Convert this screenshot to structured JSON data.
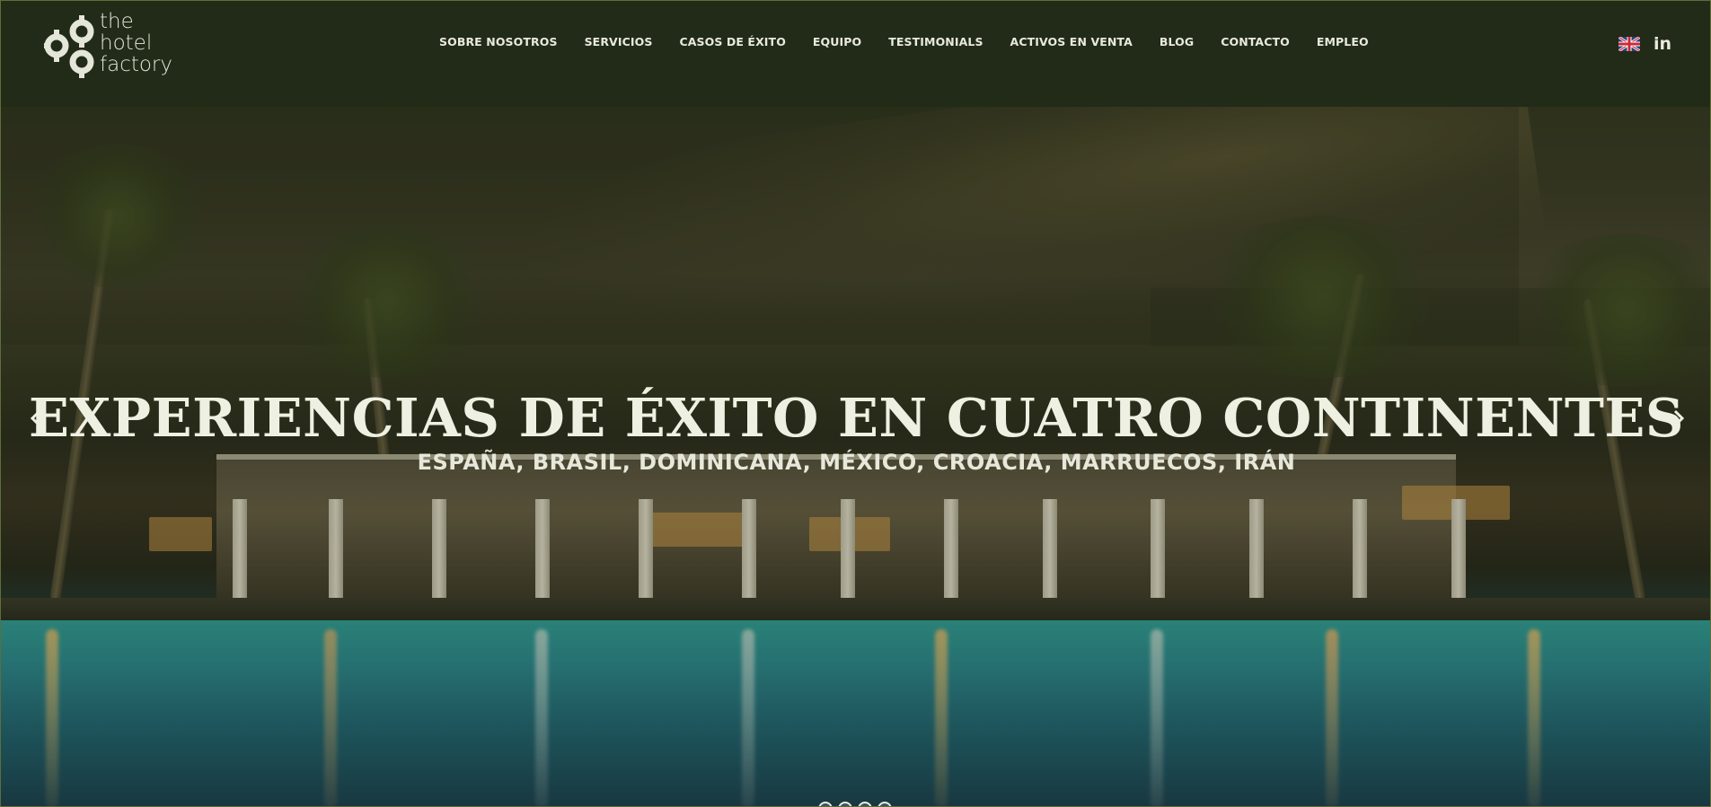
{
  "brand": {
    "logo_line1": "the",
    "logo_line2": "hotel",
    "logo_line3": "factory",
    "logo_icon": "gears-icon"
  },
  "nav": {
    "items": [
      {
        "label": "SOBRE NOSOTROS"
      },
      {
        "label": "SERVICIOS"
      },
      {
        "label": "CASOS DE ÉXITO"
      },
      {
        "label": "EQUIPO"
      },
      {
        "label": "TESTIMONIALS"
      },
      {
        "label": "ACTIVOS EN VENTA"
      },
      {
        "label": "BLOG"
      },
      {
        "label": "CONTACTO"
      },
      {
        "label": "EMPLEO"
      }
    ],
    "language_flag": "uk-flag-icon",
    "social_label": "in"
  },
  "slider": {
    "headline": "EXPERIENCIAS DE ÉXITO EN CUATRO CONTINENTES",
    "subline": "ESPAÑA, BRASIL, DOMINICANA, MÉXICO, CROACIA, MARRUECOS, IRÁN",
    "prev_icon": "chevron-left-icon",
    "next_icon": "chevron-right-icon",
    "slide_count": 4,
    "active_slide": 1
  },
  "colors": {
    "header_bg": "#222a18",
    "text": "#e8eadc",
    "pool": "#2fa6a0"
  }
}
